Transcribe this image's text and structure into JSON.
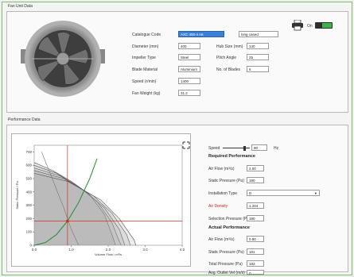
{
  "fan_data": {
    "title": "Fan Unit Data",
    "catalogue_code": {
      "label": "Catalogue Code",
      "value": "AXC 400-4 A6",
      "extra": "long cased"
    },
    "diameter": {
      "label": "Diameter (mm)",
      "value": "400"
    },
    "hub_size": {
      "label": "Hub Size (mm)",
      "value": "130"
    },
    "impeller_type": {
      "label": "Impeller Type",
      "value": "Steel"
    },
    "pitch_angle": {
      "label": "Pitch Angle",
      "value": "25"
    },
    "blade_material": {
      "label": "Blade Material",
      "value": "Aluminium"
    },
    "no_of_blades": {
      "label": "No. of Blades",
      "value": "6"
    },
    "speed": {
      "label": "Speed (r/min)",
      "value": "1400"
    },
    "fan_weight": {
      "label": "Fan Weight (kg)",
      "value": "31.2"
    },
    "toggle_label": "On"
  },
  "performance": {
    "title": "Performance Data",
    "speed_label": "Speed",
    "speed_value": "90",
    "speed_unit": "Hz",
    "required_heading": "Required Performance",
    "air_flow": {
      "label": "Air Flow (m³/s)",
      "value": "2.00"
    },
    "static_pressure": {
      "label": "Static Pressure (Pa)",
      "value": "180"
    },
    "installation_type": {
      "label": "Installation Type",
      "value": "D"
    },
    "air_density": {
      "label": "Air Density",
      "value": "1.204"
    },
    "selection_pressure": {
      "label": "Selection Pressure (Pa)",
      "value": "180"
    },
    "actual_heading": "Actual Performance",
    "act_air_flow": {
      "label": "Air Flow (m³/s)",
      "value": "0.90"
    },
    "act_static_pressure": {
      "label": "Static Pressure (Pa)",
      "value": "181"
    },
    "total_pressure": {
      "label": "Total Pressure (Pa)",
      "value": "183"
    },
    "outlet_velocity": {
      "label": "Avg. Outlet Vel (m/s)",
      "value": "0"
    }
  },
  "chart_data": {
    "type": "line",
    "ylabel": "Static Pressure / Pa",
    "xlabel": "Volume Flow / m³/s",
    "xticks": [
      "0.0",
      "1.0",
      "2.0",
      "3.0",
      "4.0"
    ],
    "yticks": [
      "700",
      "600",
      "500",
      "400",
      "300",
      "200",
      "100",
      "0"
    ],
    "xlim": [
      0,
      4
    ],
    "ylim": [
      0,
      750
    ],
    "operating_point": {
      "x": 0.9,
      "y": 181
    },
    "series": [
      {
        "values": [
          [
            0,
            620
          ],
          [
            0.5,
            560
          ],
          [
            1.0,
            480
          ],
          [
            1.5,
            380
          ],
          [
            1.9,
            230
          ],
          [
            2.1,
            80
          ],
          [
            2.2,
            0
          ]
        ]
      },
      {
        "values": [
          [
            0,
            600
          ],
          [
            0.6,
            540
          ],
          [
            1.2,
            440
          ],
          [
            1.7,
            330
          ],
          [
            2.1,
            170
          ],
          [
            2.3,
            30
          ],
          [
            2.35,
            0
          ]
        ]
      },
      {
        "values": [
          [
            0,
            580
          ],
          [
            0.7,
            520
          ],
          [
            1.4,
            400
          ],
          [
            1.9,
            280
          ],
          [
            2.3,
            120
          ],
          [
            2.45,
            0
          ]
        ]
      },
      {
        "values": [
          [
            0,
            560
          ],
          [
            0.8,
            500
          ],
          [
            1.6,
            370
          ],
          [
            2.1,
            240
          ],
          [
            2.5,
            80
          ],
          [
            2.6,
            0
          ]
        ]
      },
      {
        "values": [
          [
            0,
            540
          ],
          [
            0.9,
            480
          ],
          [
            1.8,
            340
          ],
          [
            2.3,
            200
          ],
          [
            2.7,
            40
          ],
          [
            2.75,
            0
          ]
        ]
      }
    ],
    "system_curve": [
      [
        0,
        0
      ],
      [
        0.3,
        20
      ],
      [
        0.6,
        80
      ],
      [
        0.9,
        181
      ],
      [
        1.2,
        320
      ],
      [
        1.5,
        500
      ],
      [
        1.7,
        650
      ]
    ],
    "power_curve": [
      [
        0.2,
        700
      ],
      [
        0.4,
        560
      ],
      [
        0.6,
        420
      ],
      [
        0.8,
        280
      ],
      [
        1.0,
        120
      ],
      [
        1.2,
        0
      ]
    ],
    "colors": {
      "fan": "#555555",
      "system": "#1f8f2a",
      "marker": "#d03020",
      "power": "#777777"
    }
  }
}
